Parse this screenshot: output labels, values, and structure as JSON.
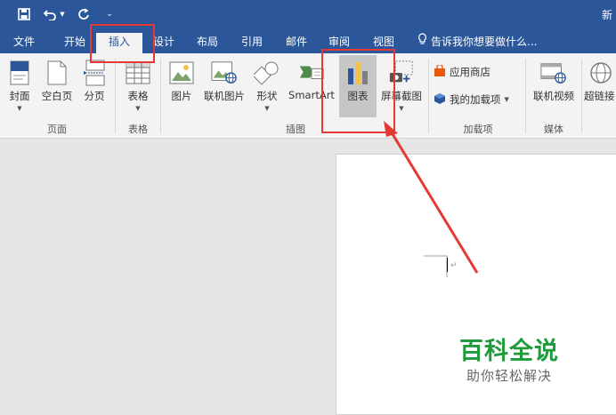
{
  "titlebar": {
    "title_fragment": "新",
    "save_icon": "save-icon",
    "undo_icon": "undo-icon",
    "redo_icon": "redo-icon",
    "customize_icon": "customize-qat-icon"
  },
  "menu": {
    "tabs": [
      "文件",
      "开始",
      "插入",
      "设计",
      "布局",
      "引用",
      "邮件",
      "审阅",
      "视图"
    ],
    "active_tab": "插入",
    "tell_me": "告诉我你想要做什么..."
  },
  "ribbon": {
    "pages_group": {
      "label": "页面",
      "buttons": [
        "封面",
        "空白页",
        "分页"
      ]
    },
    "tables_group": {
      "label": "表格",
      "buttons": [
        "表格"
      ]
    },
    "illustrations_group": {
      "label": "插图",
      "buttons": [
        "图片",
        "联机图片",
        "形状",
        "SmartArt",
        "图表",
        "屏幕截图"
      ]
    },
    "addins_group": {
      "label": "加载项",
      "store": "应用商店",
      "my_addins": "我的加载项"
    },
    "media_group": {
      "label": "媒体",
      "buttons": [
        "联机视频"
      ]
    },
    "links_group": {
      "buttons": [
        "超链接"
      ]
    }
  },
  "watermark": {
    "title": "百科全说",
    "subtitle": "助你轻松解决"
  },
  "colors": {
    "accent": "#2b579a",
    "annotation": "#e53935",
    "watermark": "#1e9b3a"
  }
}
